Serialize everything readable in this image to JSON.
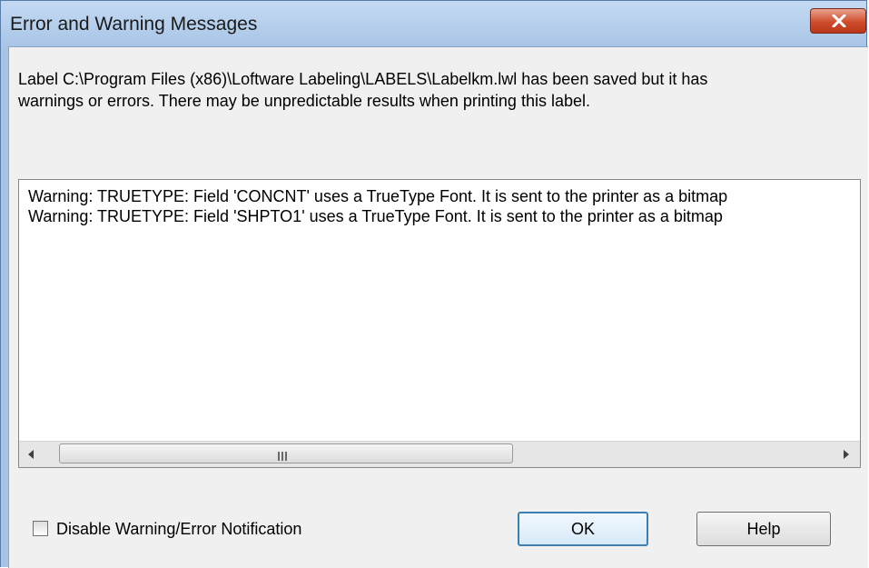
{
  "window": {
    "title": "Error and Warning Messages",
    "close_icon": "close-x-icon",
    "colors": {
      "titlebar": "#b6cfec",
      "close_button": "#cf4d2d",
      "client": "#f0f0f0"
    }
  },
  "message": {
    "line1": "Label C:\\Program Files (x86)\\Loftware Labeling\\LABELS\\Labelkm.lwl has been saved but it has",
    "line2": "warnings or errors.  There may be unpredictable results when printing this label."
  },
  "log": {
    "lines": [
      "Warning: TRUETYPE:  Field 'CONCNT' uses a TrueType Font.  It is sent to the printer as a bitmap",
      "Warning: TRUETYPE:  Field 'SHPTO1' uses a TrueType Font.  It is sent to the printer as a bitmap"
    ]
  },
  "footer": {
    "checkbox_label": "Disable Warning/Error Notification",
    "checkbox_checked": false,
    "ok_label": "OK",
    "help_label": "Help"
  }
}
